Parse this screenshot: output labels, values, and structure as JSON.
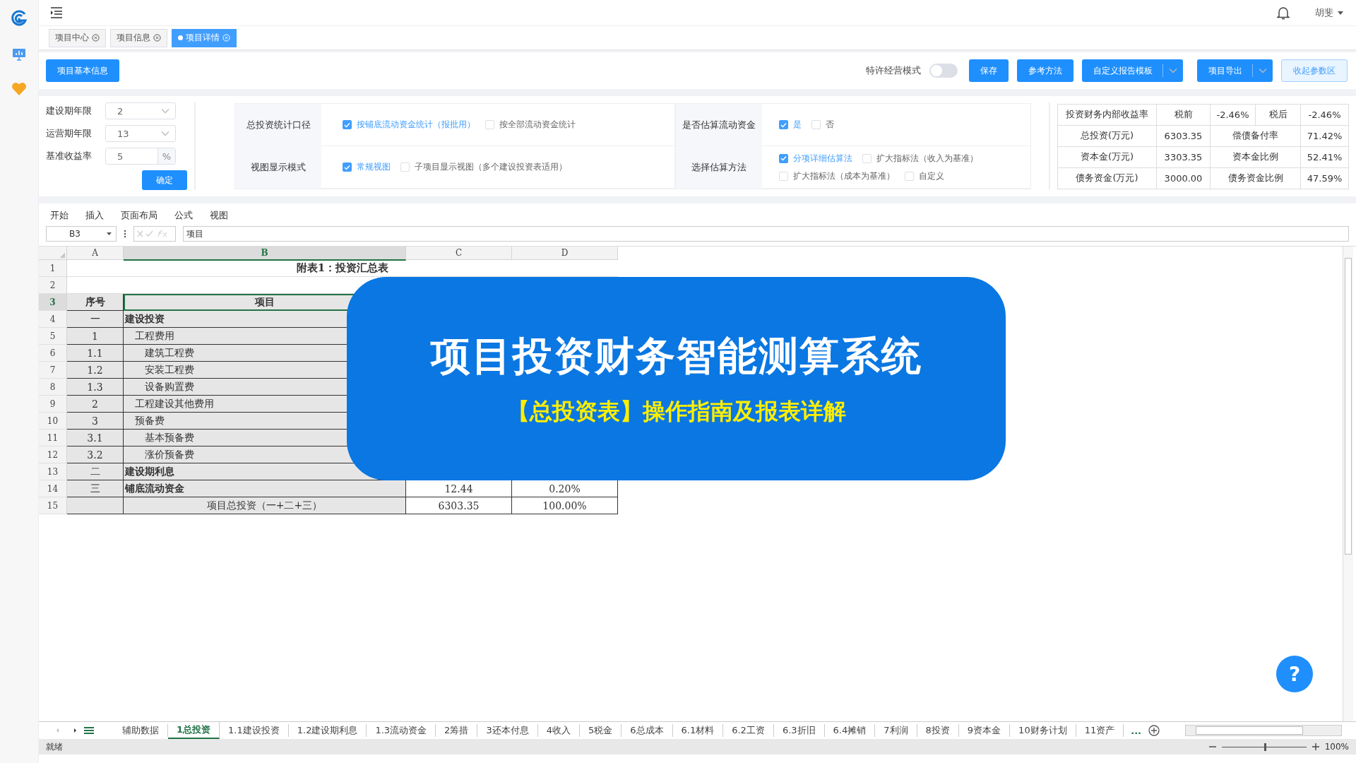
{
  "header": {
    "user": "胡斐"
  },
  "tabs": [
    {
      "label": "项目中心",
      "selected": false
    },
    {
      "label": "项目信息",
      "selected": false
    },
    {
      "label": "项目详情",
      "selected": true
    }
  ],
  "toolbar": {
    "info_button": "项目基本信息",
    "mode_label": "特许经营模式",
    "mode_on": false,
    "buttons": [
      {
        "label": "保存",
        "kind": "plain"
      },
      {
        "label": "参考方法",
        "kind": "plain"
      },
      {
        "label": "自定义报告模板",
        "kind": "split"
      },
      {
        "label": "项目导出",
        "kind": "split"
      },
      {
        "label": "收起参数区",
        "kind": "light"
      }
    ]
  },
  "params": {
    "fields": [
      {
        "label": "建设期年限",
        "value": "2",
        "kind": "select"
      },
      {
        "label": "运营期年限",
        "value": "13",
        "kind": "select"
      },
      {
        "label": "基准收益率",
        "value": "5",
        "kind": "unit",
        "unit": "%"
      }
    ],
    "confirm": "确定"
  },
  "option_panels": [
    {
      "groups": [
        {
          "label": "总投资统计口径",
          "choices": [
            {
              "label": "按铺底流动资金统计（报批用）",
              "checked": true
            },
            {
              "label": "按全部流动资金统计",
              "checked": false
            }
          ]
        },
        {
          "label": "视图显示模式",
          "choices": [
            {
              "label": "常规视图",
              "checked": true
            },
            {
              "label": "子项目显示视图（多个建设投资表适用）",
              "checked": false
            }
          ]
        }
      ]
    },
    {
      "groups": [
        {
          "label": "是否估算流动资金",
          "choices": [
            {
              "label": "是",
              "checked": true
            },
            {
              "label": "否",
              "checked": false
            }
          ]
        },
        {
          "label": "选择估算方法",
          "choices": [
            {
              "label": "分项详细估算法",
              "checked": true
            },
            {
              "label": "扩大指标法（收入为基准）",
              "checked": false
            },
            {
              "label": "扩大指标法（成本为基准）",
              "checked": false
            },
            {
              "label": "自定义",
              "checked": false
            }
          ]
        }
      ]
    }
  ],
  "metrics": [
    [
      "投资财务内部收益率",
      "税前",
      "-2.46%",
      "税后",
      "-2.46%"
    ],
    [
      "总投资(万元)",
      "6303.35",
      "偿债备付率",
      "71.42%"
    ],
    [
      "资本金(万元)",
      "3303.35",
      "资本金比例",
      "52.41%"
    ],
    [
      "债务资金(万元)",
      "3000.00",
      "债务资金比例",
      "47.59%"
    ]
  ],
  "sheet": {
    "menu": [
      "开始",
      "插入",
      "页面布局",
      "公式",
      "视图"
    ],
    "cell_ref": "B3",
    "formula": "项目",
    "columns": [
      {
        "label": "A",
        "selected": false
      },
      {
        "label": "B",
        "selected": true
      },
      {
        "label": "C",
        "selected": false
      },
      {
        "label": "D",
        "selected": false
      }
    ],
    "title_row": {
      "num": "1",
      "text": "附表1：投资汇总表"
    },
    "blank_row": {
      "num": "2"
    },
    "header_row": {
      "num": "3",
      "selected": true,
      "cells": [
        "序号",
        "项目"
      ]
    },
    "rows": [
      {
        "num": "4",
        "seq": "一",
        "name": "建设投资",
        "kind": "section",
        "children": [
          {
            "num": "5",
            "seq": "1",
            "name": "工程费用",
            "kind": "item",
            "children": [
              {
                "num": "6",
                "seq": "1.1",
                "name": "建筑工程费",
                "kind": "item"
              },
              {
                "num": "7",
                "seq": "1.2",
                "name": "安装工程费",
                "kind": "item"
              },
              {
                "num": "8",
                "seq": "1.3",
                "name": "设备购置费",
                "kind": "item"
              }
            ]
          },
          {
            "num": "9",
            "seq": "2",
            "name": "工程建设其他费用",
            "kind": "item"
          },
          {
            "num": "10",
            "seq": "3",
            "name": "预备费",
            "kind": "item",
            "children": [
              {
                "num": "11",
                "seq": "3.1",
                "name": "基本预备费",
                "kind": "item"
              },
              {
                "num": "12",
                "seq": "3.2",
                "name": "涨价预备费",
                "kind": "item"
              }
            ]
          }
        ]
      },
      {
        "num": "13",
        "seq": "二",
        "name": "建设期利息",
        "kind": "section"
      },
      {
        "num": "14",
        "seq": "三",
        "name": "铺底流动资金",
        "kind": "section",
        "c": "12.44",
        "d": "0.20%"
      },
      {
        "num": "15",
        "name": "项目总投资（一+二+三）",
        "kind": "total",
        "c": "6303.35",
        "d": "100.00%"
      }
    ],
    "sheet_tabs": [
      {
        "label": "辅助数据",
        "selected": false
      },
      {
        "label": "1总投资",
        "selected": true
      },
      {
        "label": "1.1建设投资",
        "selected": false
      },
      {
        "label": "1.2建设期利息",
        "selected": false
      },
      {
        "label": "1.3流动资金",
        "selected": false
      },
      {
        "label": "2筹措",
        "selected": false
      },
      {
        "label": "3还本付息",
        "selected": false
      },
      {
        "label": "4收入",
        "selected": false
      },
      {
        "label": "5税金",
        "selected": false
      },
      {
        "label": "6总成本",
        "selected": false
      },
      {
        "label": "6.1材料",
        "selected": false
      },
      {
        "label": "6.2工资",
        "selected": false
      },
      {
        "label": "6.3折旧",
        "selected": false
      },
      {
        "label": "6.4摊销",
        "selected": false
      },
      {
        "label": "7利润",
        "selected": false
      },
      {
        "label": "8投资",
        "selected": false
      },
      {
        "label": "9资本金",
        "selected": false
      },
      {
        "label": "10财务计划",
        "selected": false
      },
      {
        "label": "11资产",
        "selected": false
      }
    ],
    "more_tabs": "...",
    "status": "就绪",
    "zoom": "100%",
    "zoom_slider": {
      "level": 0.5
    }
  },
  "banner": {
    "title": "项目投资财务智能测算系统",
    "subtitle": "【总投资表】操作指南及报表详解"
  },
  "help_button": "?"
}
